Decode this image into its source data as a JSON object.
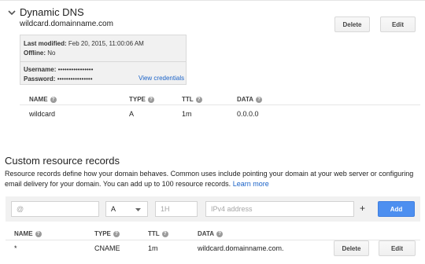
{
  "dynamic_dns": {
    "title": "Dynamic DNS",
    "domain": "wildcard.domainname.com",
    "delete_label": "Delete",
    "edit_label": "Edit",
    "panel": {
      "last_modified_label": "Last modified:",
      "last_modified_value": "Feb 20, 2015, 11:00:06 AM",
      "offline_label": "Offline:",
      "offline_value": "No",
      "username_label": "Username:",
      "username_value": "••••••••••••••••",
      "password_label": "Password:",
      "password_value": "••••••••••••••••",
      "view_credentials": "View credentials"
    },
    "table": {
      "headers": [
        "NAME",
        "TYPE",
        "TTL",
        "DATA"
      ],
      "row": {
        "name": "wildcard",
        "type": "A",
        "ttl": "1m",
        "data": "0.0.0.0"
      }
    }
  },
  "custom": {
    "title": "Custom resource records",
    "description": "Resource records define how your domain behaves. Common uses include pointing your domain at your web server or configuring email delivery for your domain. You can add up to 100 resource records.",
    "learn_more": "Learn more",
    "add_form": {
      "name_placeholder": "@",
      "type_value": "A",
      "ttl_placeholder": "1H",
      "data_placeholder": "IPv4 address",
      "plus": "+",
      "add_label": "Add"
    },
    "table": {
      "headers": [
        "NAME",
        "TYPE",
        "TTL",
        "DATA"
      ],
      "row": {
        "name": "*",
        "type": "CNAME",
        "ttl": "1m",
        "data": "wildcard.domainname.com."
      },
      "delete_label": "Delete",
      "edit_label": "Edit"
    }
  },
  "icons": [
    "chevron-down-icon",
    "help-icon",
    "dropdown-arrow-icon"
  ]
}
